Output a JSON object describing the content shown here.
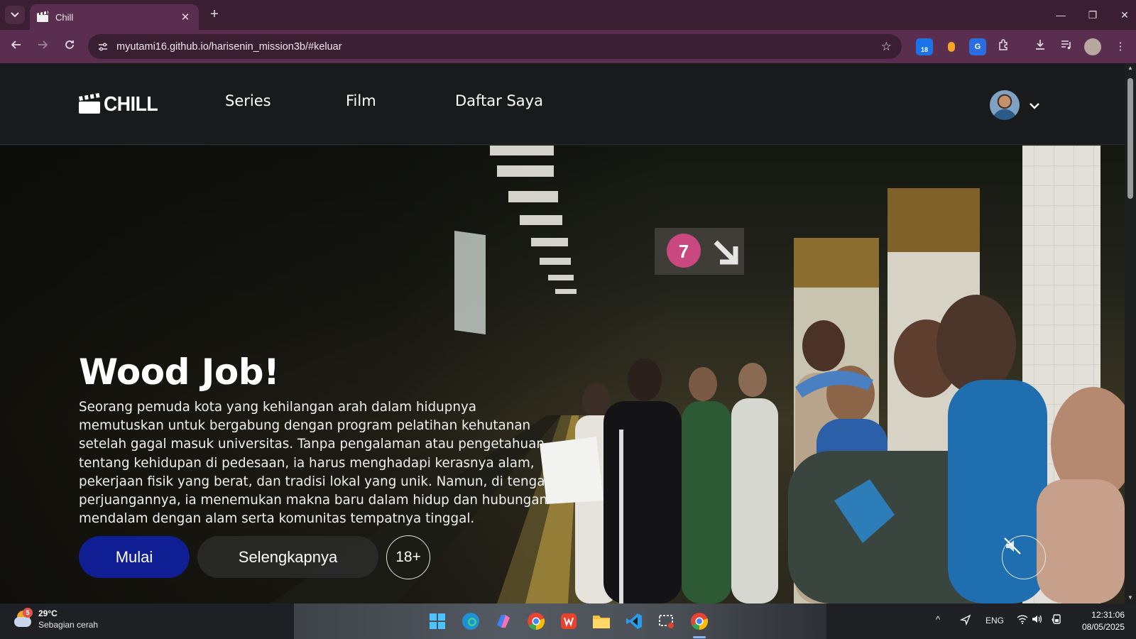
{
  "browser": {
    "tab_title": "Chill",
    "url": "myutami16.github.io/harisenin_mission3b/#keluar",
    "extension_badge": "18"
  },
  "site": {
    "logo_text": "CHILL",
    "nav": [
      "Series",
      "Film",
      "Daftar Saya"
    ]
  },
  "hero": {
    "title": "Wood Job!",
    "description": "Seorang pemuda kota yang kehilangan arah dalam hidupnya memutuskan untuk bergabung dengan program pelatihan kehutanan setelah gagal masuk universitas. Tanpa pengalaman atau pengetahuan tentang kehidupan di pedesaan, ia harus menghadapi kerasnya alam, pekerjaan fisik yang berat, dan tradisi lokal yang unik. Namun, di tengah perjuangannya, ia menemukan makna baru dalam hidup dan hubungan mendalam dengan alam serta komunitas tempatnya tinggal.",
    "start_label": "Mulai",
    "more_label": "Selengkapnya",
    "rating": "18+",
    "mute_icon": "speaker-muted-icon",
    "sign_number": "7"
  },
  "taskbar": {
    "weather_badge": "5",
    "temperature": "29°C",
    "condition": "Sebagian cerah",
    "language": "ENG",
    "time": "12:31:06",
    "date": "08/05/2025"
  },
  "colors": {
    "primary_button": "#0f1e93",
    "browser_frame": "#5a2e4e",
    "page_bg": "#181a1c"
  }
}
